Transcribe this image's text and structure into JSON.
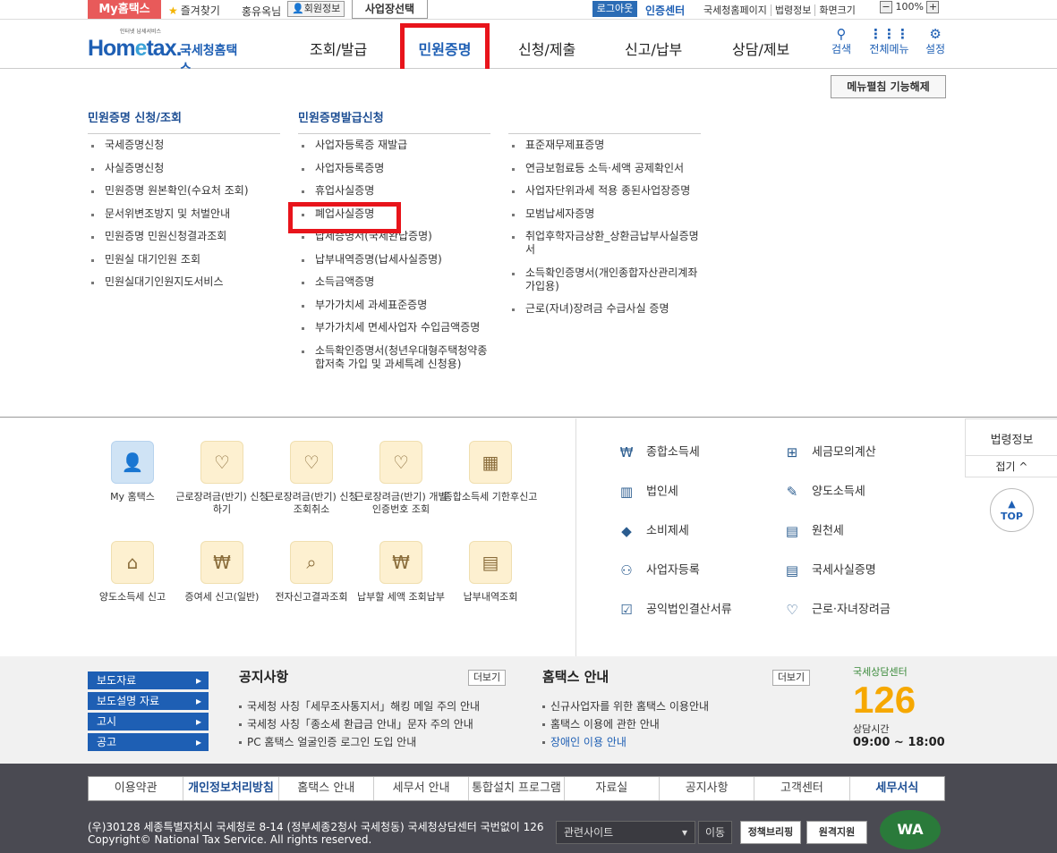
{
  "topbar": {
    "my_hometax": "My홈택스",
    "favorites": "즐겨찾기",
    "user_name": "홍유옥님",
    "member_info": "회원정보",
    "business_select": "사업장선택",
    "logout": "로그아웃",
    "cert_center": "인증센터",
    "links": [
      "국세청홈페이지",
      "법령정보",
      "화면크기"
    ],
    "zoom": "100%"
  },
  "header": {
    "logo_tagline": "인터넷 납세서비스",
    "logo_home": "Hom",
    "logo_e": "e",
    "logo_tax": "tax.",
    "logo_korean": "국세청홈택스",
    "nav": [
      "조회/발급",
      "민원증명",
      "신청/제출",
      "신고/납부",
      "상담/제보"
    ],
    "icons": [
      {
        "label": "검색",
        "icon": "search-icon"
      },
      {
        "label": "전체메뉴",
        "icon": "grid-menu-icon"
      },
      {
        "label": "설정",
        "icon": "gear-icon"
      }
    ]
  },
  "mega": {
    "menu_fold_off": "메뉴펼침 기능해제",
    "col1_title": "민원증명 신청/조회",
    "col1_items": [
      "국세증명신청",
      "사실증명신청",
      "민원증명 원본확인(수요처 조회)",
      "문서위변조방지 및 처벌안내",
      "민원증명 민원신청결과조회",
      "민원실 대기인원 조회",
      "민원실대기인원지도서비스"
    ],
    "col2_title": "민원증명발급신청",
    "col2_items": [
      "사업자등록증 재발급",
      "사업자등록증명",
      "휴업사실증명",
      "폐업사실증명",
      "납세증명서(국세완납증명)",
      "납부내역증명(납세사실증명)",
      "소득금액증명",
      "부가가치세 과세표준증명",
      "부가가치세 면세사업자 수입금액증명",
      "소득확인증명서(청년우대형주택청약종합저축 가입 및 과세특례 신청용)"
    ],
    "col3_items": [
      "표준재무제표증명",
      "연금보험료등 소득·세액 공제확인서",
      "사업자단위과세 적용 종된사업장증명",
      "모범납세자증명",
      "취업후학자금상환_상환금납부사실증명서",
      "소득확인증명서(개인종합자산관리계좌 가입용)",
      "근로(자녀)장려금 수급사실 증명"
    ]
  },
  "quick": {
    "tiles": [
      {
        "label": "My 홈택스"
      },
      {
        "label": "근로장려금(반기) 신청하기"
      },
      {
        "label": "근로장려금(반기) 신청조회취소"
      },
      {
        "label": "근로장려금(반기) 개별인증번호 조회"
      },
      {
        "label": "종합소득세 기한후신고"
      },
      {
        "label": "양도소득세 신고"
      },
      {
        "label": "증여세 신고(일반)"
      },
      {
        "label": "전자신고결과조회"
      },
      {
        "label": "납부할 세액 조회납부"
      },
      {
        "label": "납부내역조회"
      }
    ],
    "tax_items": [
      "종합소득세",
      "세금모의계산",
      "법인세",
      "양도소득세",
      "소비제세",
      "원천세",
      "사업자등록",
      "국세사실증명",
      "공익법인결산서류",
      "근로·자녀장려금"
    ]
  },
  "side": {
    "law_info": "법령정보",
    "fold": "접기 ^",
    "top": "TOP"
  },
  "notice": {
    "left_buttons": [
      "보도자료",
      "보도설명 자료",
      "고시",
      "공고"
    ],
    "notice_title": "공지사항",
    "more": "더보기",
    "notice_items": [
      "국세청 사칭「세무조사통지서」해킹 메일 주의 안내",
      "국세청 사칭「종소세 환급금 안내」문자 주의 안내",
      "PC 홈택스 얼굴인증 로그인 도입 안내"
    ],
    "guide_title": "홈택스 안내",
    "guide_items": [
      "신규사업자를 위한 홈택스 이용안내",
      "홈택스 이용에 관한 안내",
      "장애인 이용 안내"
    ],
    "center_label": "국세상담센터",
    "center_num": "126",
    "center_hours_label": "상담시간",
    "center_hours": "09:00 ~ 18:00"
  },
  "footer": {
    "menu": [
      "이용약관",
      "개인정보처리방침",
      "홈택스 안내",
      "세무서 안내",
      "통합설치 프로그램",
      "자료실",
      "공지사항",
      "고객센터",
      "세무서식"
    ],
    "address": "(우)30128 세종특별자치시 국세청로 8-14 (정부세종2청사 국세청동) 국세청상담센터 국번없이 126",
    "copyright": "Copyright© National Tax Service. All rights reserved.",
    "related_site": "관련사이트",
    "move": "이동",
    "policy_briefing": "정책브리핑",
    "remote_support": "원격지원",
    "wa_mark": "WA"
  }
}
